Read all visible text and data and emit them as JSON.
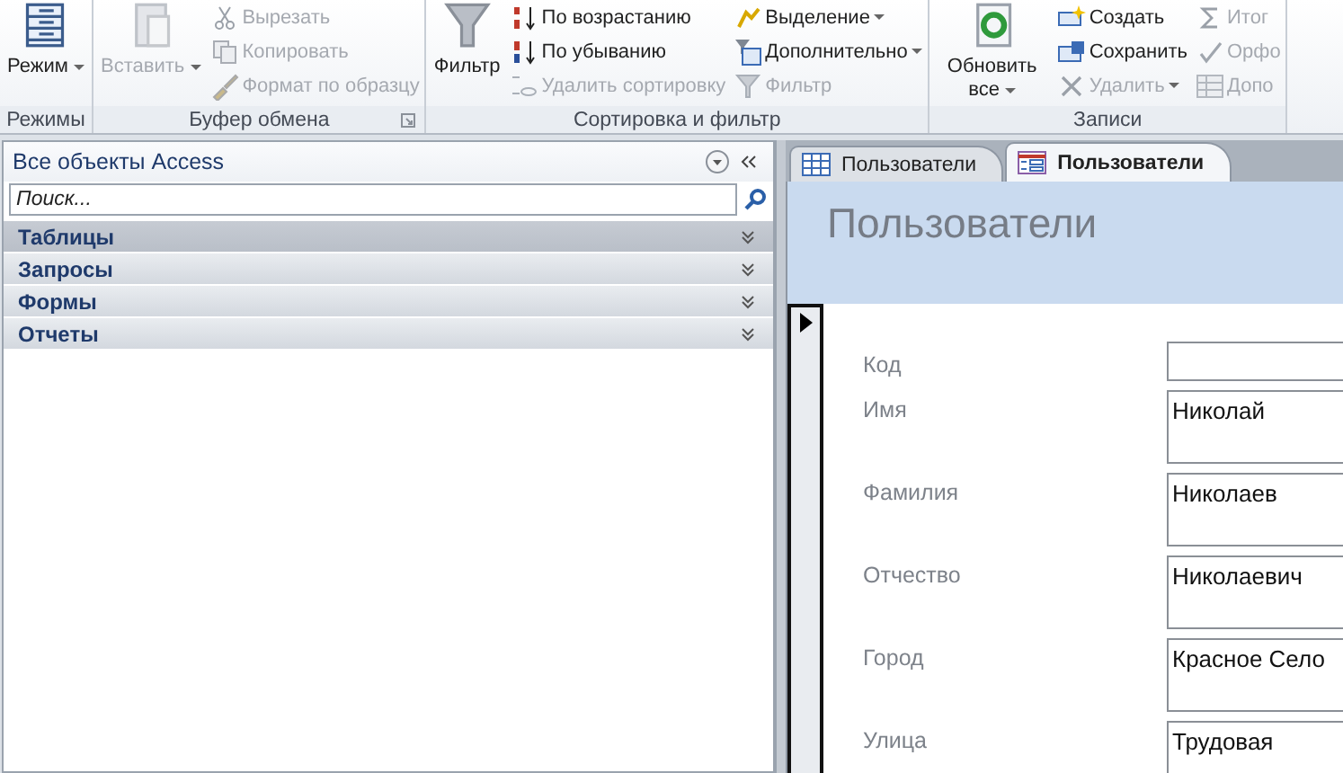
{
  "ribbon": {
    "groups": [
      {
        "label": "Режимы",
        "launcher": false,
        "large": [
          {
            "text": "Режим",
            "disabled": false,
            "dropdown": true
          }
        ]
      },
      {
        "label": "Буфер обмена",
        "launcher": true,
        "large": [
          {
            "text": "Вставить",
            "disabled": true,
            "dropdown": true
          }
        ],
        "columns": [
          [
            {
              "text": "Вырезать",
              "disabled": true,
              "dropdown": false
            },
            {
              "text": "Копировать",
              "disabled": true,
              "dropdown": false
            },
            {
              "text": "Формат по образцу",
              "disabled": true,
              "dropdown": false
            }
          ]
        ]
      },
      {
        "label": "Сортировка и фильтр",
        "launcher": false,
        "large": [
          {
            "text": "Фильтр",
            "disabled": false,
            "dropdown": false
          }
        ],
        "columns": [
          [
            {
              "text": "По возрастанию",
              "disabled": false,
              "dropdown": false
            },
            {
              "text": "По убыванию",
              "disabled": false,
              "dropdown": false
            },
            {
              "text": "Удалить сортировку",
              "disabled": true,
              "dropdown": false
            }
          ],
          [
            {
              "text": "Выделение",
              "disabled": false,
              "dropdown": true
            },
            {
              "text": "Дополнительно",
              "disabled": false,
              "dropdown": true
            },
            {
              "text": "Фильтр",
              "disabled": true,
              "dropdown": false
            }
          ]
        ]
      },
      {
        "label": "Записи",
        "launcher": false,
        "large": [
          {
            "text": "Обновить все",
            "disabled": false,
            "dropdown": true
          }
        ],
        "columns": [
          [
            {
              "text": "Создать",
              "disabled": false,
              "dropdown": false
            },
            {
              "text": "Сохранить",
              "disabled": false,
              "dropdown": false
            },
            {
              "text": "Удалить",
              "disabled": true,
              "dropdown": true
            }
          ],
          [
            {
              "text": "Итог",
              "disabled": true,
              "dropdown": false
            },
            {
              "text": "Орфо",
              "disabled": true,
              "dropdown": false
            },
            {
              "text": "Допо",
              "disabled": true,
              "dropdown": false
            }
          ]
        ]
      }
    ]
  },
  "nav": {
    "title": "Все объекты Access",
    "search": {
      "placeholder": "Поиск..."
    },
    "sections": [
      {
        "label": "Таблицы",
        "expanded": false,
        "selected": true
      },
      {
        "label": "Запросы",
        "expanded": false,
        "selected": false
      },
      {
        "label": "Формы",
        "expanded": false,
        "selected": false
      },
      {
        "label": "Отчеты",
        "expanded": false,
        "selected": false
      }
    ]
  },
  "tabs": [
    {
      "label": "Пользователи",
      "kind": "table",
      "selected": false
    },
    {
      "label": "Пользователи",
      "kind": "form",
      "selected": true
    }
  ],
  "form": {
    "title": "Пользователи",
    "fields": [
      {
        "label": "Код",
        "kind": "short"
      },
      {
        "label": "Имя",
        "value": "Николай",
        "kind": "tall"
      },
      {
        "label": "Фамилия",
        "value": "Николаев",
        "kind": "tall"
      },
      {
        "label": "Отчество",
        "value": "Николаевич",
        "kind": "tall"
      },
      {
        "label": "Город",
        "value": "Красное Село",
        "kind": "tall"
      },
      {
        "label": "Улица",
        "value": "Трудовая",
        "kind": "tall"
      }
    ]
  }
}
